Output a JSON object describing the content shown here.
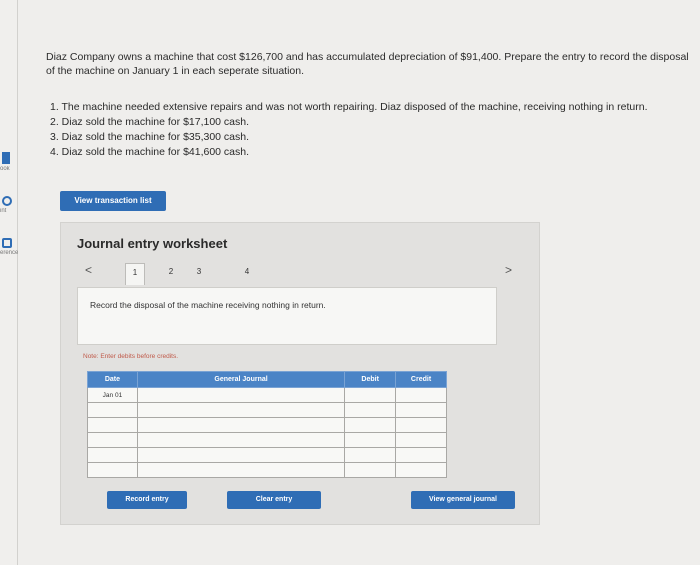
{
  "left_rail": {
    "items": [
      {
        "label": "ook",
        "icon": "book-icon"
      },
      {
        "label": "int",
        "icon": "hint-icon"
      },
      {
        "label": "erences",
        "icon": "references-icon"
      }
    ]
  },
  "problem": {
    "intro": "Diaz Company owns a machine that cost $126,700 and has accumulated depreciation of $91,400. Prepare the entry to record the disposal of the machine on January 1 in each seperate situation.",
    "situations": [
      "1. The machine needed extensive repairs and was not worth repairing. Diaz disposed of the machine, receiving nothing in return.",
      "2. Diaz sold the machine for $17,100 cash.",
      "3. Diaz sold the machine for $35,300 cash.",
      "4. Diaz sold the machine for $41,600 cash."
    ]
  },
  "buttons": {
    "view_transactions": "View transaction list",
    "record_entry": "Record entry",
    "clear_entry": "Clear entry",
    "view_general_journal": "View general journal"
  },
  "worksheet": {
    "title": "Journal entry worksheet",
    "pager": {
      "prev": "<",
      "next": ">",
      "pages": [
        "1",
        "2",
        "3",
        "4"
      ],
      "active_page": "1"
    },
    "instruction": "Record the disposal of the machine receiving nothing in return.",
    "note": "Note: Enter debits before credits.",
    "table": {
      "headers": {
        "date": "Date",
        "journal": "General Journal",
        "debit": "Debit",
        "credit": "Credit"
      },
      "rows": [
        {
          "date": "Jan 01",
          "journal": "",
          "debit": "",
          "credit": ""
        },
        {
          "date": "",
          "journal": "",
          "debit": "",
          "credit": ""
        },
        {
          "date": "",
          "journal": "",
          "debit": "",
          "credit": ""
        },
        {
          "date": "",
          "journal": "",
          "debit": "",
          "credit": ""
        },
        {
          "date": "",
          "journal": "",
          "debit": "",
          "credit": ""
        },
        {
          "date": "",
          "journal": "",
          "debit": "",
          "credit": ""
        }
      ]
    }
  },
  "colors": {
    "accent": "#2f6db5",
    "table_header": "#4b84c6",
    "note": "#c05a4a"
  }
}
